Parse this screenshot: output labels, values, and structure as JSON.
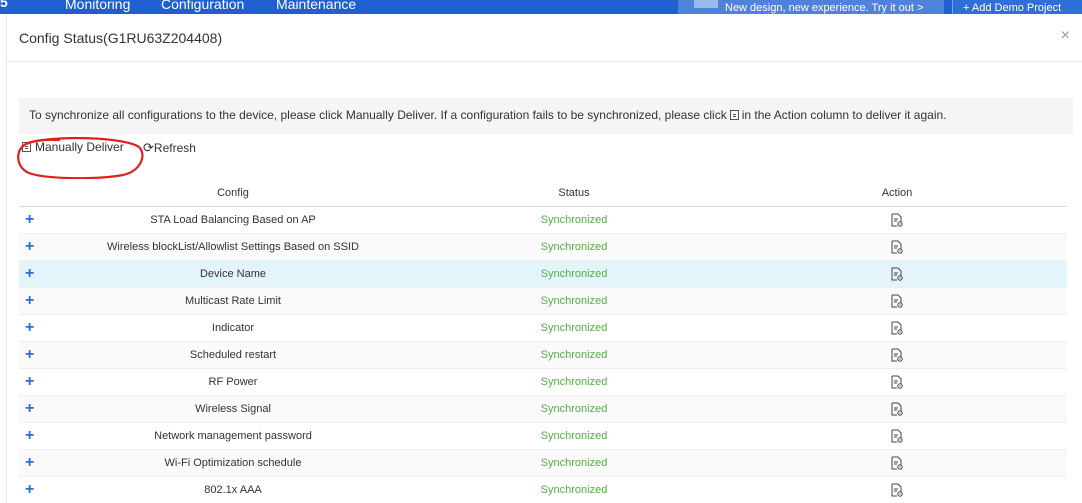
{
  "appbar": {
    "nav": [
      "Monitoring",
      "Configuration",
      "Maintenance"
    ],
    "promo": "New design, new experience. Try it out",
    "demo": "+ Add Demo Project"
  },
  "modal": {
    "title": "Config Status(G1RU63Z204408)",
    "close": "×",
    "notice_before": "To synchronize all configurations to the device, please click Manually Deliver. If a configuration fails to be synchronized, please click",
    "notice_after": "in the Action column to deliver it again.",
    "toolbar": {
      "deliver": "Manually Deliver",
      "refresh": "Refresh"
    },
    "columns": {
      "config": "Config",
      "status": "Status",
      "action": "Action"
    },
    "rows": [
      {
        "config": "STA Load Balancing Based on AP",
        "status": "Synchronized"
      },
      {
        "config": "Wireless blockList/Allowlist Settings Based on SSID",
        "status": "Synchronized"
      },
      {
        "config": "Device Name",
        "status": "Synchronized"
      },
      {
        "config": "Multicast Rate Limit",
        "status": "Synchronized"
      },
      {
        "config": "Indicator",
        "status": "Synchronized"
      },
      {
        "config": "Scheduled restart",
        "status": "Synchronized"
      },
      {
        "config": "RF Power",
        "status": "Synchronized"
      },
      {
        "config": "Wireless Signal",
        "status": "Synchronized"
      },
      {
        "config": "Network management password",
        "status": "Synchronized"
      },
      {
        "config": "Wi-Fi Optimization schedule",
        "status": "Synchronized"
      },
      {
        "config": "802.1x AAA",
        "status": "Synchronized"
      }
    ]
  },
  "colors": {
    "accent": "#2a6ed4",
    "status_ok": "#52b043",
    "highlight_row": "#e4f4fb",
    "annotation": "#e0201c"
  }
}
